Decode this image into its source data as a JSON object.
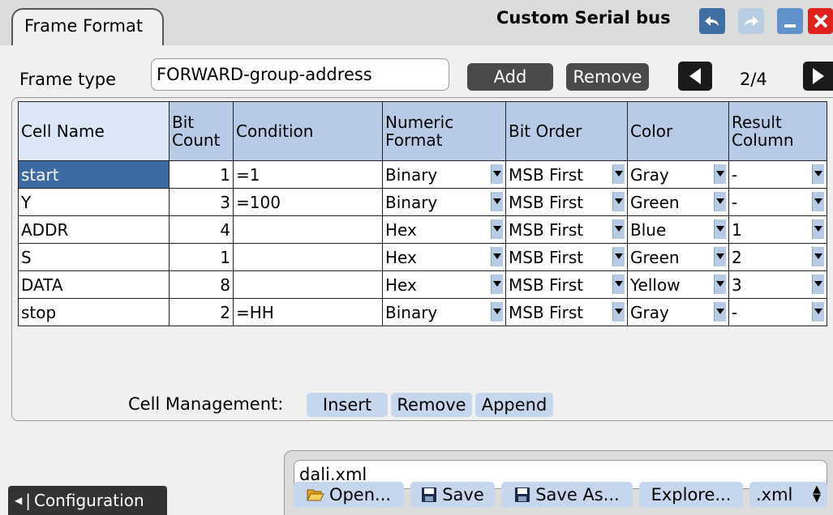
{
  "tab_label": "Frame Format",
  "window_title": "Custom Serial bus",
  "frame_type": {
    "label": "Frame type",
    "value": "FORWARD-group-address",
    "add_label": "Add",
    "remove_label": "Remove",
    "page_indicator": "2/4"
  },
  "table": {
    "headers": {
      "cell_name": "Cell Name",
      "bit_count": "Bit\nCount",
      "condition": "Condition",
      "numeric_format": "Numeric\nFormat",
      "bit_order": "Bit Order",
      "color": "Color",
      "result_column": "Result\nColumn"
    },
    "rows": [
      {
        "name": "start",
        "count": "1",
        "cond": "=1",
        "fmt": "Binary",
        "order": "MSB First",
        "color": "Gray",
        "result": "-"
      },
      {
        "name": "Y",
        "count": "3",
        "cond": "=100",
        "fmt": "Binary",
        "order": "MSB First",
        "color": "Green",
        "result": "-"
      },
      {
        "name": "ADDR",
        "count": "4",
        "cond": "",
        "fmt": "Hex",
        "order": "MSB First",
        "color": "Blue",
        "result": "1"
      },
      {
        "name": "S",
        "count": "1",
        "cond": "",
        "fmt": "Hex",
        "order": "MSB First",
        "color": "Green",
        "result": "2"
      },
      {
        "name": "DATA",
        "count": "8",
        "cond": "",
        "fmt": "Hex",
        "order": "MSB First",
        "color": "Yellow",
        "result": "3"
      },
      {
        "name": "stop",
        "count": "2",
        "cond": "=HH",
        "fmt": "Binary",
        "order": "MSB First",
        "color": "Gray",
        "result": "-"
      }
    ]
  },
  "cell_management": {
    "label": "Cell Management:",
    "insert": "Insert",
    "remove": "Remove",
    "append": "Append"
  },
  "file": {
    "name": "dali.xml",
    "open": "Open...",
    "save": "Save",
    "save_as": "Save As...",
    "explore": "Explore...",
    "ext": ".xml"
  },
  "configuration_label": "Configuration",
  "colors": {
    "header_bg": "#b8cbe6",
    "selected_cell": "#3c6aa5",
    "close_button": "#e0221e",
    "dark_button": "#4a4a4a"
  }
}
